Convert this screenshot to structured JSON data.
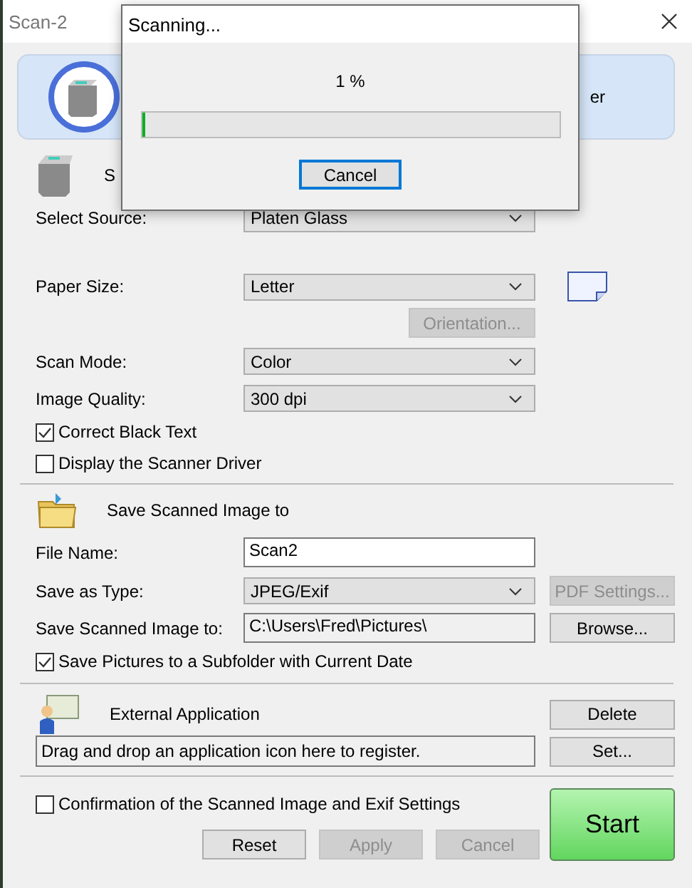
{
  "window": {
    "title": "Scan-2"
  },
  "banner": {
    "text": "er"
  },
  "source": {
    "heading": "S",
    "label": "Select Source:",
    "value": "Platen Glass"
  },
  "paper_size": {
    "label": "Paper Size:",
    "value": "Letter"
  },
  "orientation_button": {
    "label": "Orientation...",
    "disabled": true
  },
  "scan_mode": {
    "label": "Scan Mode:",
    "value": "Color"
  },
  "image_quality": {
    "label": "Image Quality:",
    "value": "300 dpi"
  },
  "options": [
    {
      "label": "Correct Black Text",
      "checked": true
    },
    {
      "label": "Display the Scanner Driver",
      "checked": false
    }
  ],
  "save": {
    "heading": "Save Scanned Image to",
    "file_name": {
      "label": "File Name:",
      "value": "Scan2"
    },
    "save_as_type": {
      "label": "Save as Type:",
      "value": "JPEG/Exif"
    },
    "pdf_settings_button": {
      "label": "PDF Settings...",
      "disabled": true
    },
    "folder": {
      "label": "Save Scanned Image to:",
      "value": "C:\\Users\\Fred\\Pictures\\"
    },
    "browse_button": {
      "label": "Browse...",
      "disabled": false
    },
    "subfolder": {
      "label": "Save Pictures to a Subfolder with Current Date",
      "checked": true
    }
  },
  "external": {
    "heading": "External Application",
    "drop_area": "Drag and drop an application icon here to register.",
    "buttons": [
      {
        "label": "Delete",
        "disabled": false
      },
      {
        "label": "Set...",
        "disabled": false
      }
    ]
  },
  "confirmation": {
    "label": "Confirmation of the Scanned Image and Exif Settings",
    "checked": false
  },
  "bottom_buttons": [
    {
      "label": "Reset",
      "disabled": false
    },
    {
      "label": "Apply",
      "disabled": true
    },
    {
      "label": "Cancel",
      "disabled": true
    }
  ],
  "start_button": {
    "label": "Start"
  },
  "dialog": {
    "title": "Scanning...",
    "percent": "1 %",
    "level": 0.01,
    "cancel_button": "Cancel"
  }
}
